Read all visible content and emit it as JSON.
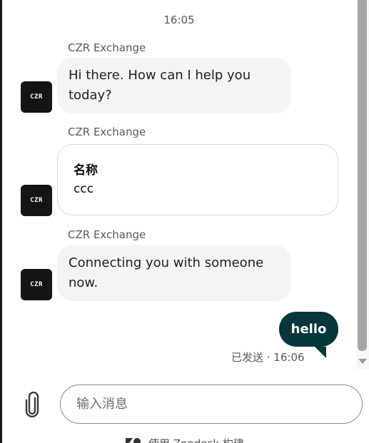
{
  "chat": {
    "timestamp": "16:05",
    "messages": [
      {
        "sender": "CZR Exchange",
        "avatar_text": "CZR",
        "text": "Hi there. How can I help you today?"
      },
      {
        "sender": "CZR Exchange",
        "avatar_text": "CZR",
        "card_title": "名称",
        "card_value": "ccc"
      },
      {
        "sender": "CZR Exchange",
        "avatar_text": "CZR",
        "text": "Connecting you with someone now."
      }
    ],
    "outgoing": {
      "text": "hello",
      "status": "已发送 · 16:06"
    }
  },
  "composer": {
    "placeholder": "输入消息",
    "value": "",
    "attach_icon": "paperclip-icon"
  },
  "footer": {
    "brand_icon": "zendesk-logo-icon",
    "text": "使用 Zendesk 构建"
  },
  "colors": {
    "outgoing_bubble": "#06373a",
    "incoming_bubble": "#f3f4f6",
    "avatar_bg": "#141414"
  }
}
